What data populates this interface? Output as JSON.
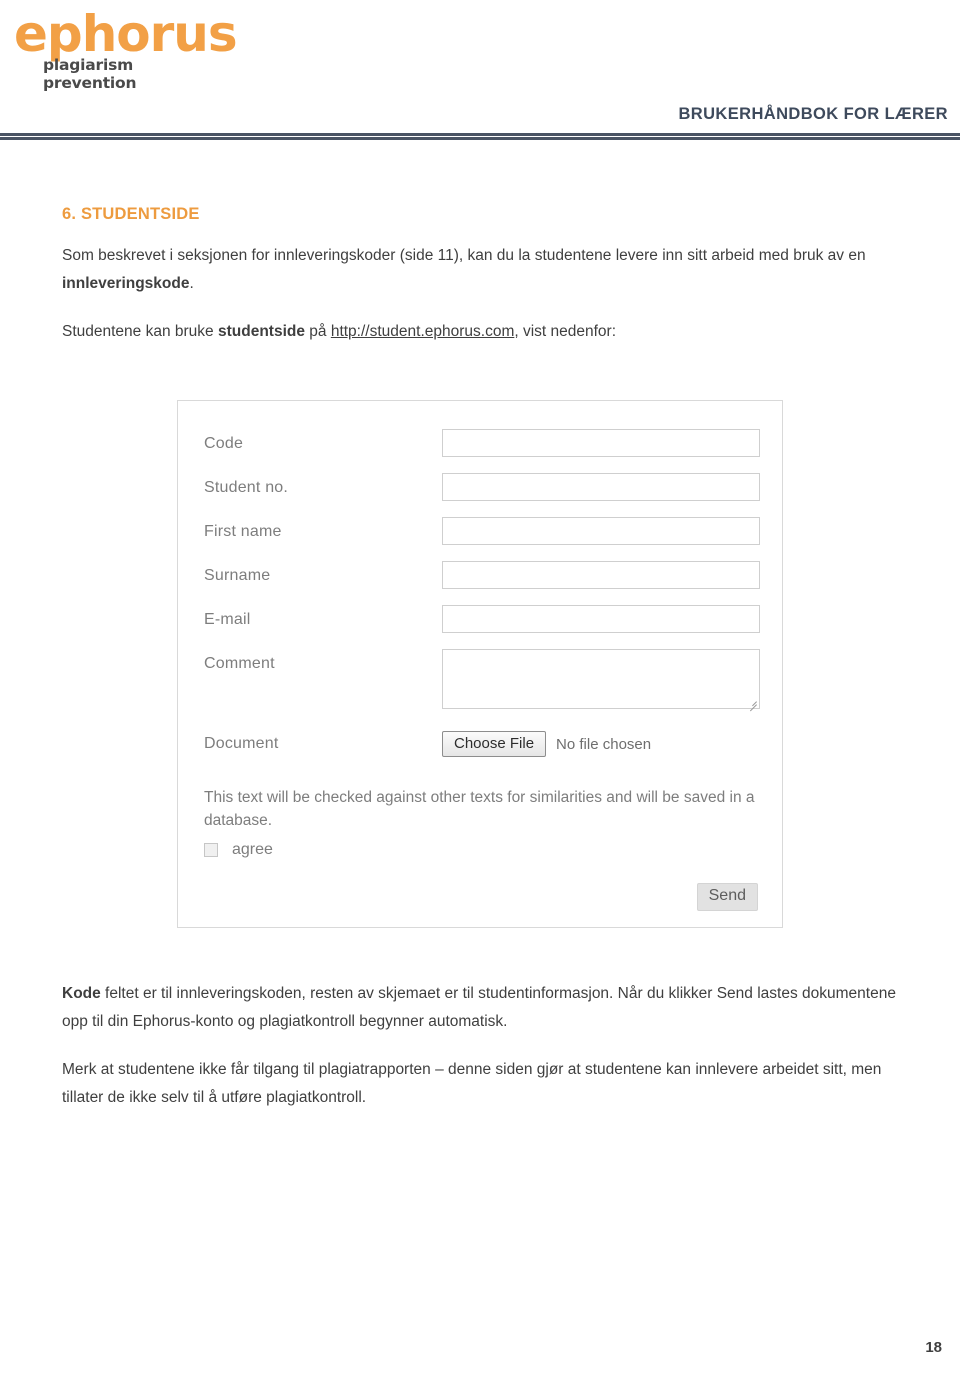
{
  "header": {
    "logo_word": "ephorus",
    "logo_tagline": "plagiarism prevention",
    "title": "BRUKERHÅNDBOK FOR LÆRER",
    "brand_orange": "#F2A046",
    "rule_color": "#4a5464"
  },
  "section": {
    "heading": "6. STUDENTSIDE",
    "heading_color": "#ED9B3F",
    "paragraph1_part1": "Som beskrevet i seksjonen for innleveringskoder (side 11), kan du la studentene levere inn sitt arbeid med bruk av en ",
    "paragraph1_bold": "innleveringskode",
    "paragraph1_part2": ".",
    "paragraph2_part1": "Studentene kan bruke ",
    "paragraph2_bold": "studentside",
    "paragraph2_part2": " på ",
    "paragraph2_link": "http://student.ephorus.com",
    "paragraph2_part3": ", vist nedenfor:"
  },
  "form_screenshot": {
    "fields": [
      {
        "label": "Code",
        "type": "text",
        "value": ""
      },
      {
        "label": "Student no.",
        "type": "text",
        "value": ""
      },
      {
        "label": "First name",
        "type": "text",
        "value": ""
      },
      {
        "label": "Surname",
        "type": "text",
        "value": ""
      },
      {
        "label": "E-mail",
        "type": "text",
        "value": ""
      },
      {
        "label": "Comment",
        "type": "textarea",
        "value": ""
      }
    ],
    "document_label": "Document",
    "choose_file_label": "Choose File",
    "no_file_label": "No file chosen",
    "disclaimer": "This text will be checked against other texts for similarities and will be saved in a database.",
    "agree_label": "agree",
    "agree_checked": false,
    "send_label": "Send"
  },
  "lower": {
    "paragraph3_bold": "Kode",
    "paragraph3_rest": " feltet er til innleveringskoden, resten av skjemaet er til studentinformasjon. Når du klikker Send lastes dokumentene opp til din Ephorus-konto og plagiatkontroll begynner automatisk.",
    "paragraph4": "Merk at studentene ikke får tilgang til plagiatrapporten – denne siden gjør at studentene kan innlevere arbeidet sitt, men tillater de ikke selv til å utføre plagiatkontroll."
  },
  "footer": {
    "page_number": "18"
  }
}
